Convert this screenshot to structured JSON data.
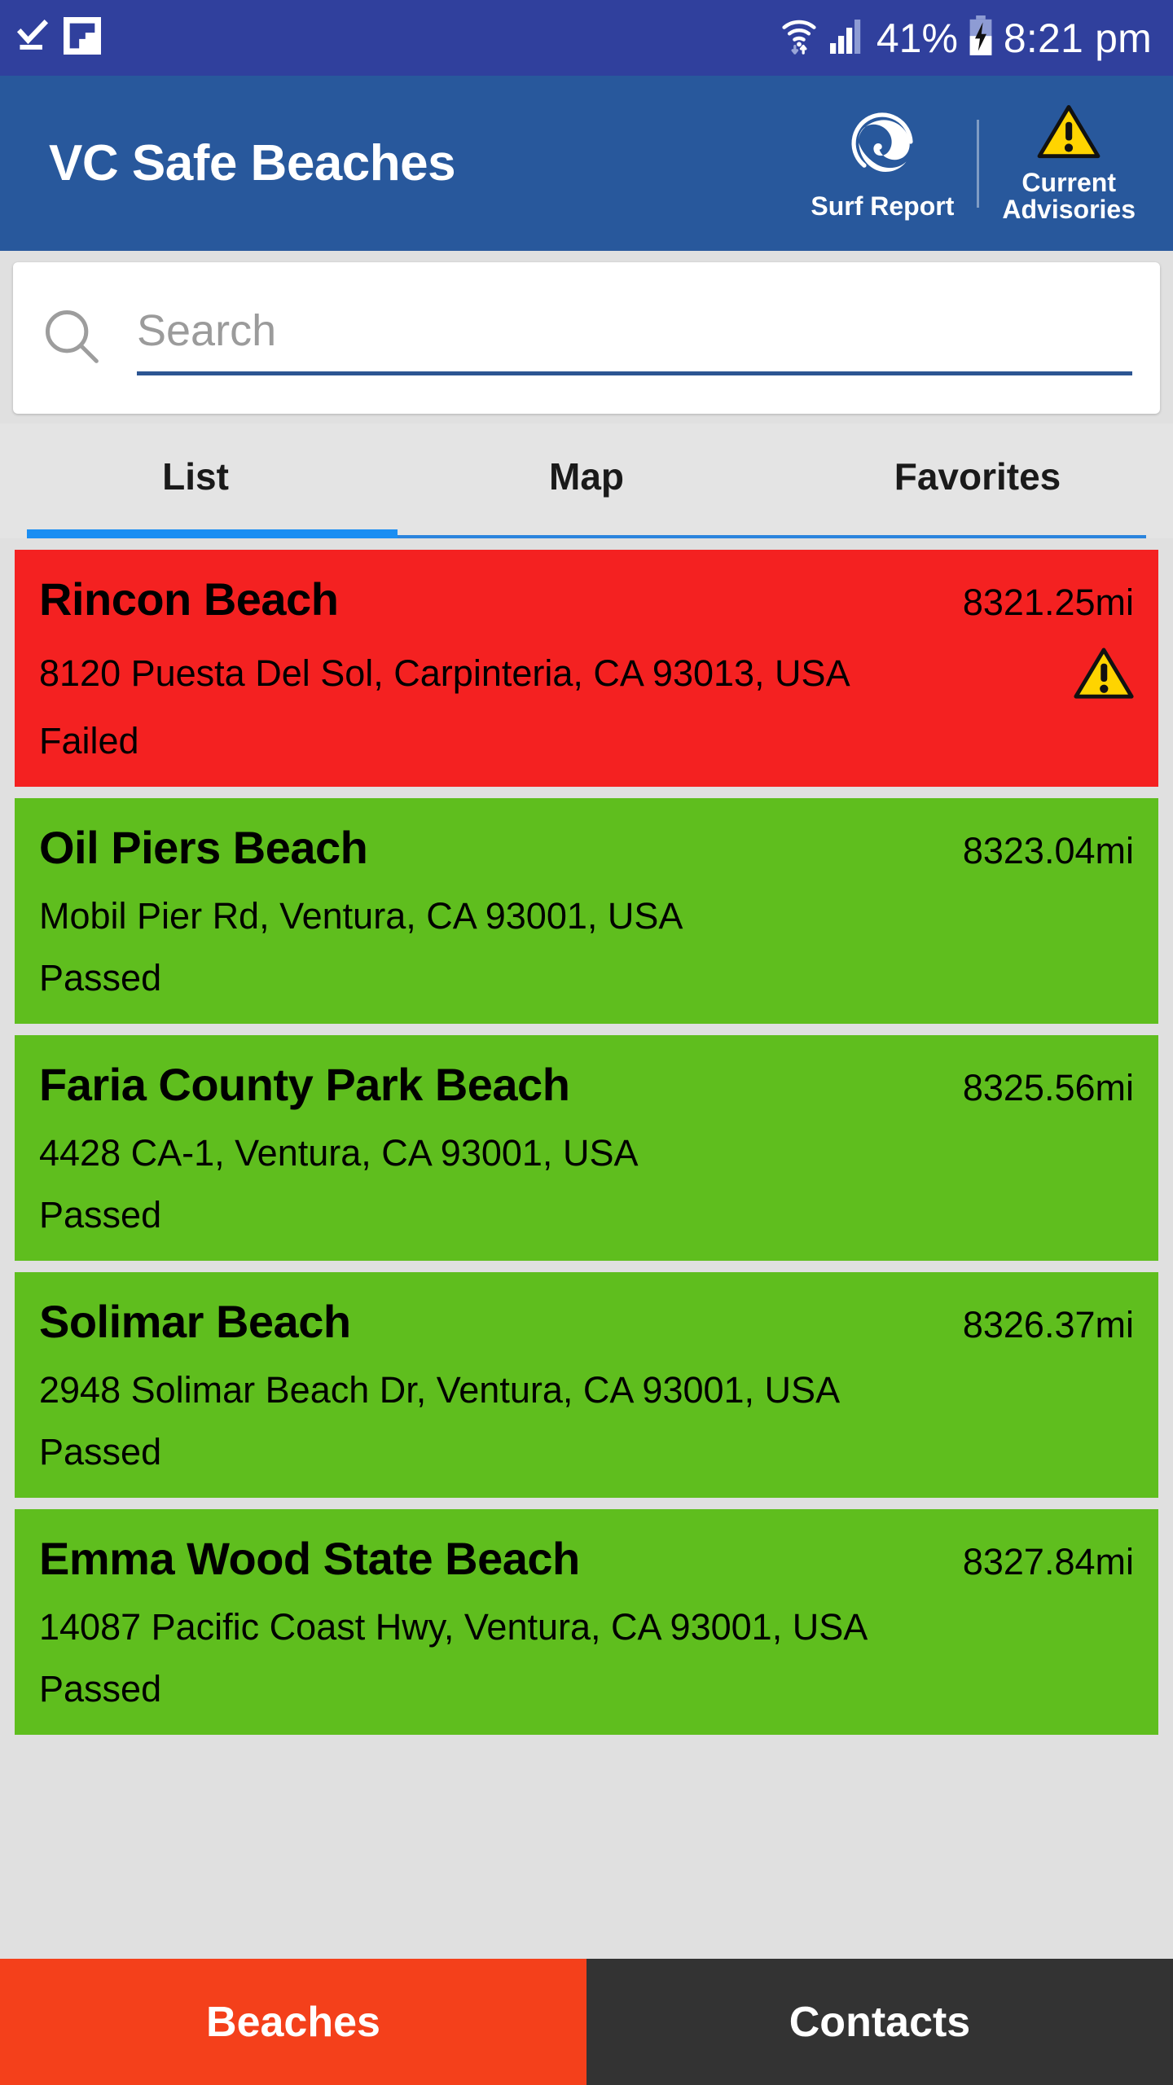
{
  "status_bar": {
    "icons": [
      "download-complete-icon",
      "flipboard-icon",
      "wifi-icon",
      "cellular-signal-icon",
      "battery-charging-icon"
    ],
    "battery_percent": "41%",
    "time": "8:21 pm"
  },
  "app_bar": {
    "title": "VC Safe Beaches",
    "actions": [
      {
        "name": "surf-report",
        "label": "Surf Report",
        "icon": "wave-icon"
      },
      {
        "name": "current-advisories",
        "label": "Current\nAdvisories",
        "icon": "warning-triangle-icon"
      }
    ]
  },
  "search": {
    "placeholder": "Search",
    "value": "",
    "icon": "search-icon"
  },
  "tabs": {
    "items": [
      {
        "label": "List",
        "active": true
      },
      {
        "label": "Map",
        "active": false
      },
      {
        "label": "Favorites",
        "active": false
      }
    ],
    "active_index": 0,
    "indicator_color": "#1b8ef2"
  },
  "beaches": [
    {
      "name": "Rincon Beach",
      "distance": "8321.25mi",
      "address": "8120 Puesta Del Sol, Carpinteria, CA 93013, USA",
      "status": "Failed",
      "result": "fail",
      "color": "#f42121",
      "has_advisory": true
    },
    {
      "name": "Oil Piers Beach",
      "distance": "8323.04mi",
      "address": "Mobil Pier Rd, Ventura, CA 93001, USA",
      "status": "Passed",
      "result": "pass",
      "color": "#5fbe1e",
      "has_advisory": false
    },
    {
      "name": "Faria County Park Beach",
      "distance": "8325.56mi",
      "address": "4428 CA-1, Ventura, CA 93001, USA",
      "status": "Passed",
      "result": "pass",
      "color": "#5fbe1e",
      "has_advisory": false
    },
    {
      "name": "Solimar Beach",
      "distance": "8326.37mi",
      "address": "2948 Solimar Beach Dr, Ventura, CA 93001, USA",
      "status": "Passed",
      "result": "pass",
      "color": "#5fbe1e",
      "has_advisory": false
    },
    {
      "name": "Emma Wood State Beach",
      "distance": "8327.84mi",
      "address": "14087 Pacific Coast Hwy, Ventura, CA 93001, USA",
      "status": "Passed",
      "result": "pass",
      "color": "#5fbe1e",
      "has_advisory": false
    }
  ],
  "bottom_nav": {
    "items": [
      {
        "label": "Beaches",
        "active": true
      },
      {
        "label": "Contacts",
        "active": false
      }
    ]
  },
  "colors": {
    "status_bar": "#30409d",
    "app_bar": "#28589c",
    "page_background": "#e0e0e0",
    "pass": "#5fbe1e",
    "fail": "#f42121",
    "nav_active": "#f4401b",
    "nav_inactive": "#333333",
    "warning_yellow": "#ffd400"
  }
}
